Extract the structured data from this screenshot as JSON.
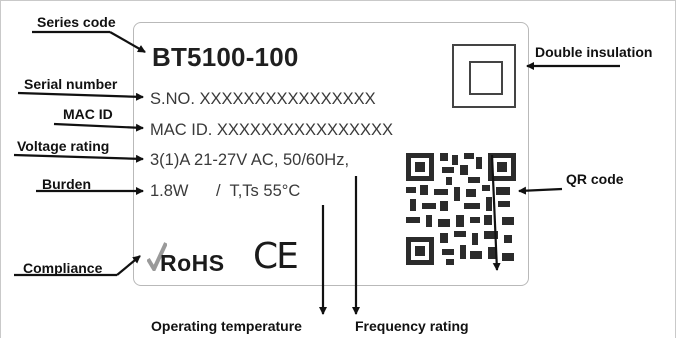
{
  "label": {
    "model": "BT5100-100",
    "serial_line": "S.NO. XXXXXXXXXXXXXXXX",
    "mac_line": "MAC ID. XXXXXXXXXXXXXXXX",
    "voltage_line": "3(1)A 21-27V AC, 50/60Hz,",
    "burden_line": "1.8W      /  T,Ts 55°C",
    "rohs": "RoHS",
    "ce": "CE"
  },
  "annotations": {
    "series_code": "Series code",
    "serial_number": "Serial number",
    "mac_id": "MAC ID",
    "voltage_rating": "Voltage rating",
    "burden": "Burden",
    "compliance": "Compliance",
    "double_insulation": "Double insulation",
    "qr_code": "QR code",
    "operating_temperature": "Operating temperature",
    "frequency_rating": "Frequency rating"
  },
  "icons": {
    "double_insulation_symbol": "double-square-icon",
    "qr": "qr-code-icon",
    "rohs_check": "checkmark-icon",
    "ce_mark": "ce-mark-icon"
  },
  "colors": {
    "label_text": "#3a3a3a",
    "annotation_text": "#111111",
    "label_border": "#b9b9b9"
  }
}
